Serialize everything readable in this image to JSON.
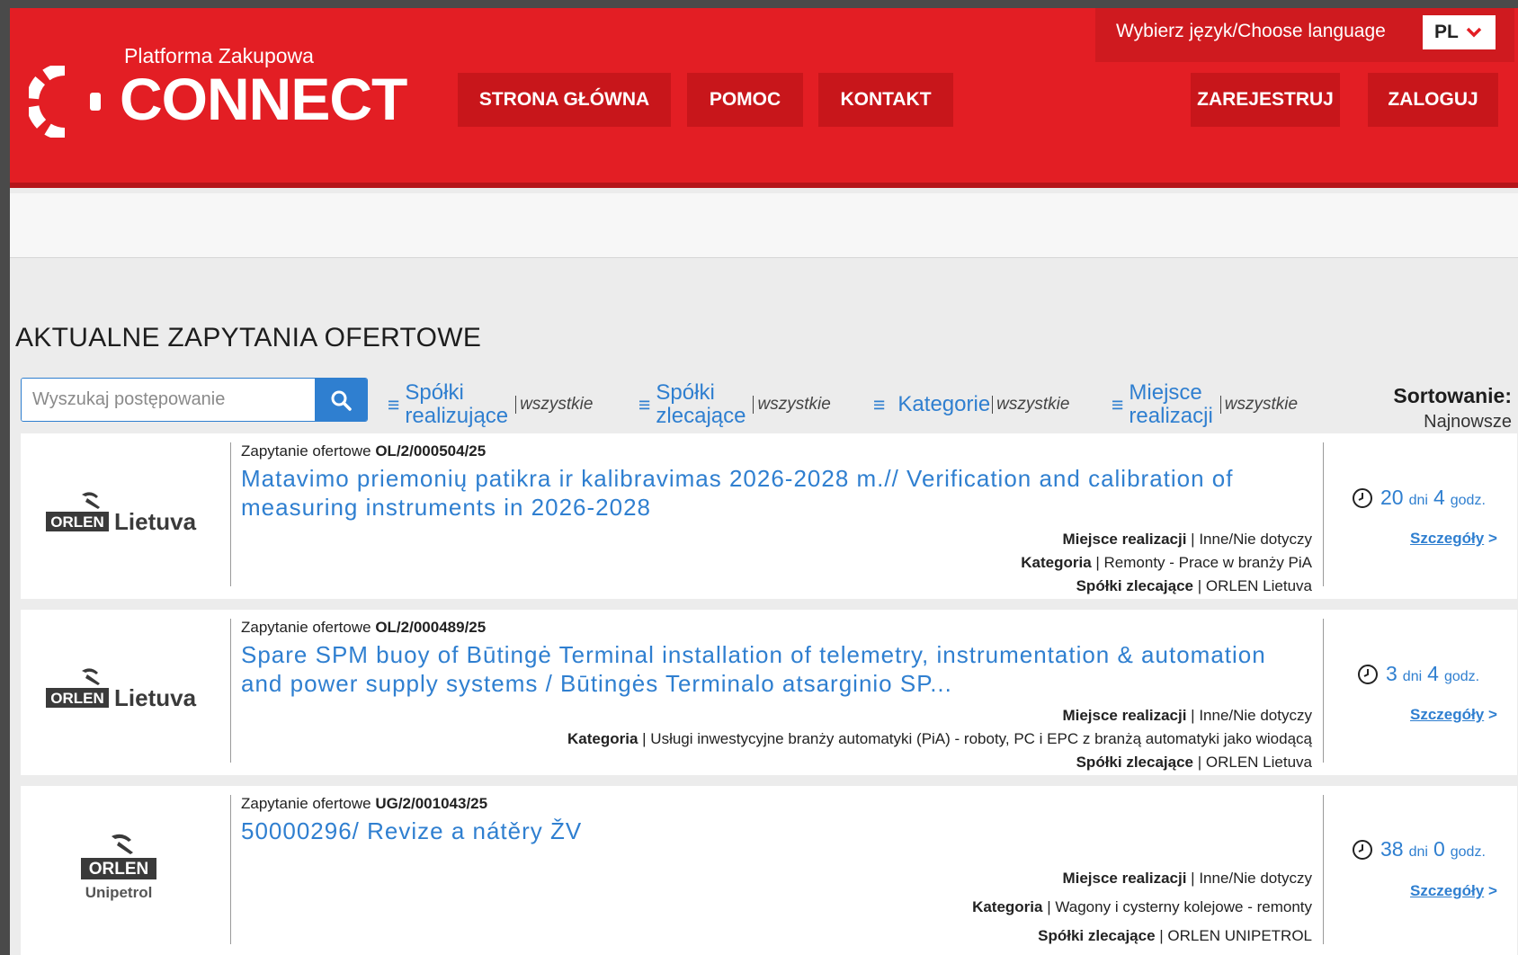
{
  "header": {
    "logo_subtitle": "Platforma Zakupowa",
    "logo_title": "CONNECT",
    "nav": [
      {
        "label": "STRONA GŁÓWNA"
      },
      {
        "label": "POMOC"
      },
      {
        "label": "KONTAKT"
      }
    ],
    "auth": [
      {
        "label": "ZAREJESTRUJ"
      },
      {
        "label": "ZALOGUJ"
      }
    ],
    "language": {
      "label": "Wybierz język/Choose language",
      "value": "PL"
    }
  },
  "main": {
    "title": "AKTUALNE ZAPYTANIA OFERTOWE",
    "search": {
      "placeholder": "Wyszukaj postępowanie"
    },
    "filters": [
      {
        "label_line1": "Spółki",
        "label_line2": "realizujące",
        "value": "wszystkie"
      },
      {
        "label_line1": "Spółki",
        "label_line2": "zlecające",
        "value": "wszystkie"
      },
      {
        "label_line1": "Kategorie",
        "label_line2": "",
        "value": "wszystkie"
      },
      {
        "label_line1": "Miejsce",
        "label_line2": "realizacji",
        "value": "wszystkie"
      }
    ],
    "sort": {
      "label": "Sortowanie:",
      "value": "Najnowsze"
    },
    "listings": [
      {
        "logo_brand": "ORLEN",
        "logo_name": "Lietuva",
        "kind": "Zapytanie ofertowe",
        "number": "OL/2/000504/25",
        "title_line1": "Matavimo priemonių patikra ir kalibravimas 2026-2028 m.// Verification and calibration of",
        "title_line2": "measuring instruments in 2026-2028",
        "place_label": "Miejsce realizacji",
        "place_value": "Inne/Nie dotyczy",
        "category_label": "Kategoria",
        "category_value": "Remonty - Prace w branży PiA",
        "company_label": "Spółki zlecające",
        "company_value": "ORLEN Lietuva",
        "days": "20",
        "days_unit": "dni",
        "hours": "4",
        "hours_unit": "godz.",
        "details": "Szczegóły",
        "details_arrow": ">"
      },
      {
        "logo_brand": "ORLEN",
        "logo_name": "Lietuva",
        "kind": "Zapytanie ofertowe",
        "number": "OL/2/000489/25",
        "title_line1": "Spare SPM buoy of Būtingė Terminal installation of telemetry, instrumentation & automation",
        "title_line2": "and power supply systems / Būtingės Terminalo atsarginio SP...",
        "place_label": "Miejsce realizacji",
        "place_value": "Inne/Nie dotyczy",
        "category_label": "Kategoria",
        "category_value": "Usługi inwestycyjne branży automatyki (PiA) - roboty, PC i EPC z branżą automatyki jako wiodącą",
        "company_label": "Spółki zlecające",
        "company_value": "ORLEN Lietuva",
        "days": "3",
        "days_unit": "dni",
        "hours": "4",
        "hours_unit": "godz.",
        "details": "Szczegóły",
        "details_arrow": ">"
      },
      {
        "logo_brand": "ORLEN",
        "logo_name": "Unipetrol",
        "kind": "Zapytanie ofertowe",
        "number": "UG/2/001043/25",
        "title_line1": "50000296/ Revize a nátěry ŽV",
        "title_line2": "",
        "place_label": "Miejsce realizacji",
        "place_value": "Inne/Nie dotyczy",
        "category_label": "Kategoria",
        "category_value": "Wagony i cysterny kolejowe - remonty",
        "company_label": "Spółki zlecające",
        "company_value": "ORLEN UNIPETROL",
        "days": "38",
        "days_unit": "dni",
        "hours": "0",
        "hours_unit": "godz.",
        "details": "Szczegóły",
        "details_arrow": ">"
      }
    ]
  },
  "colors": {
    "brand_red": "#e31e24",
    "nav_button": "#c8161b",
    "link_blue": "#2f7fd0"
  }
}
